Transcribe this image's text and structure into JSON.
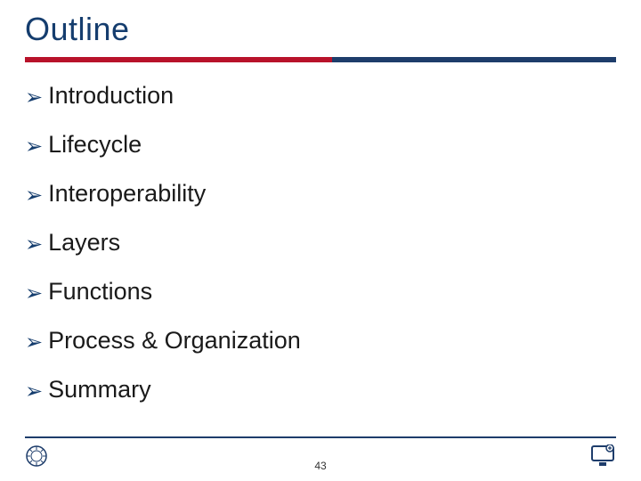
{
  "title": "Outline",
  "bullet_glyph": "➢",
  "items": [
    {
      "label": "Introduction"
    },
    {
      "label": "Lifecycle"
    },
    {
      "label": "Interoperability"
    },
    {
      "label": "Layers"
    },
    {
      "label": "Functions"
    },
    {
      "label": "Process & Organization"
    },
    {
      "label": "Summary"
    }
  ],
  "page_number": "43",
  "colors": {
    "title": "#153d6e",
    "rule_red": "#b8122a",
    "rule_blue": "#1e3d6b"
  }
}
